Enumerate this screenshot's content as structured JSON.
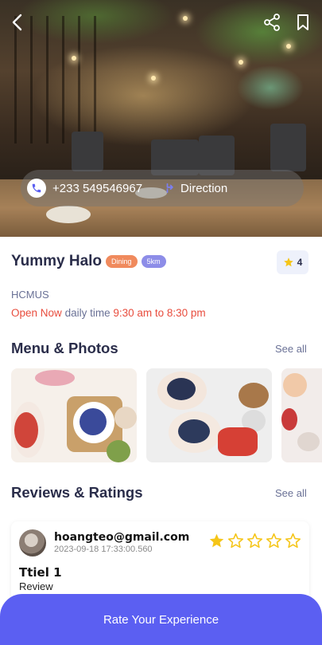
{
  "hero": {
    "phone": "+233 549546967",
    "direction_label": "Direction"
  },
  "restaurant": {
    "name": "Yummy Halo",
    "category_badge": "Dining",
    "distance_badge": "5km",
    "rating": "4",
    "organization": "HCMUS",
    "open_status": "Open Now",
    "daily_label": "daily time",
    "hours": "9:30 am to 8:30 pm"
  },
  "menu_section": {
    "title": "Menu & Photos",
    "see_all": "See all"
  },
  "reviews_section": {
    "title": "Reviews & Ratings",
    "see_all": "See all",
    "items": [
      {
        "user": "hoangteo@gmail.com",
        "timestamp": "2023-09-18 17:33:00.560",
        "rating": 1,
        "title": "Ttiel 1",
        "body": "Review"
      }
    ]
  },
  "cta": {
    "label": "Rate Your Experience"
  },
  "colors": {
    "accent": "#5b5ff2",
    "open": "#e84c3d",
    "star": "#f5c518",
    "dining_badge": "#f08a5d",
    "distance_badge": "#8d8de8"
  },
  "icons": {
    "back": "chevron-left-icon",
    "share": "share-icon",
    "bookmark": "bookmark-icon",
    "phone": "phone-icon",
    "direction": "direction-icon",
    "star": "star-icon"
  }
}
